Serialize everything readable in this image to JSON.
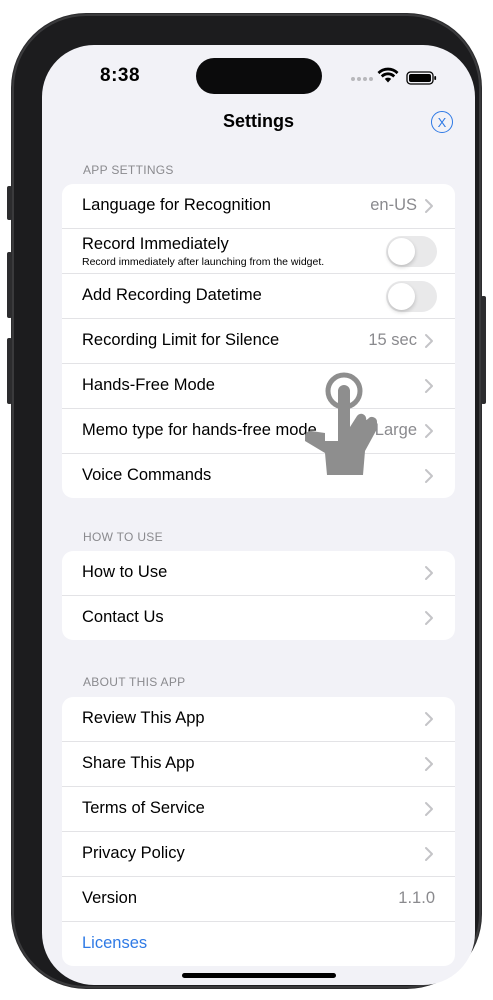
{
  "status_bar": {
    "time": "8:38"
  },
  "nav": {
    "title": "Settings",
    "close_symbol": "X"
  },
  "sections": {
    "app_settings": {
      "header": "APP SETTINGS",
      "language": {
        "label": "Language for Recognition",
        "value": "en-US"
      },
      "record_immediately": {
        "label": "Record Immediately",
        "sublabel": "Record immediately after launching from the widget.",
        "on": false
      },
      "add_datetime": {
        "label": "Add Recording Datetime",
        "on": false
      },
      "silence_limit": {
        "label": "Recording Limit for Silence",
        "value": "15 sec"
      },
      "hands_free": {
        "label": "Hands-Free Mode"
      },
      "memo_type": {
        "label": "Memo type for hands-free mode",
        "value": "Large"
      },
      "voice_commands": {
        "label": "Voice Commands"
      }
    },
    "how_to_use": {
      "header": "HOW TO USE",
      "how_to_use": {
        "label": "How to Use"
      },
      "contact": {
        "label": "Contact Us"
      }
    },
    "about": {
      "header": "ABOUT THIS APP",
      "review": {
        "label": "Review This App"
      },
      "share": {
        "label": "Share This App"
      },
      "terms": {
        "label": "Terms of Service"
      },
      "privacy": {
        "label": "Privacy Policy"
      },
      "version": {
        "label": "Version",
        "value": "1.1.0"
      },
      "licenses": {
        "label": "Licenses"
      }
    }
  },
  "overlay": {
    "icon": "tap-hand-icon"
  },
  "colors": {
    "accent": "#2f7ae5",
    "background": "#f2f2f7",
    "secondary_text": "#8a8a8e",
    "toggle_off": "#e9e9ea"
  }
}
